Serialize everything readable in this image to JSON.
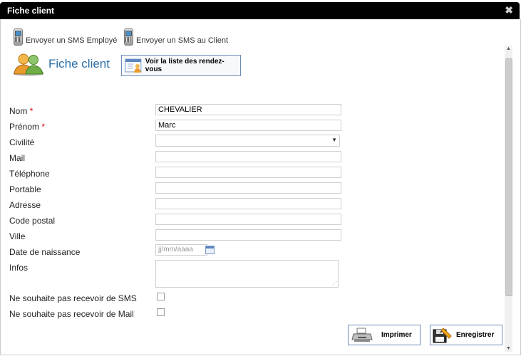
{
  "window": {
    "title": "Fiche client",
    "close_symbol": "✖"
  },
  "sms_links": {
    "employee": "Envoyer un SMS Employé",
    "client": "Envoyer un SMS au Client"
  },
  "header": {
    "title": "Fiche client",
    "rdv_button": "Voir la liste des rendez-vous"
  },
  "form": {
    "nom_label": "Nom",
    "nom_value": "CHEVALIER",
    "prenom_label": "Prénom",
    "prenom_value": "Marc",
    "required_mark": "*",
    "civilite_label": "Civilité",
    "civilite_value": "",
    "mail_label": "Mail",
    "telephone_label": "Téléphone",
    "portable_label": "Portable",
    "adresse_label": "Adresse",
    "code_postal_label": "Code postal",
    "ville_label": "Ville",
    "date_label": "Date de naissance",
    "date_placeholder": "jj/mm/aaaa",
    "infos_label": "Infos",
    "no_sms_label": "Ne souhaite pas recevoir de SMS",
    "no_sms_checked": false,
    "no_mail_label": "Ne souhaite pas recevoir de Mail",
    "no_mail_checked": false
  },
  "actions": {
    "print": "Imprimer",
    "save": "Enregistrer"
  },
  "colors": {
    "title_bar": "#000000",
    "page_title": "#2a6ea6",
    "required": "#dd0000",
    "button_border": "#6d8cb8"
  }
}
